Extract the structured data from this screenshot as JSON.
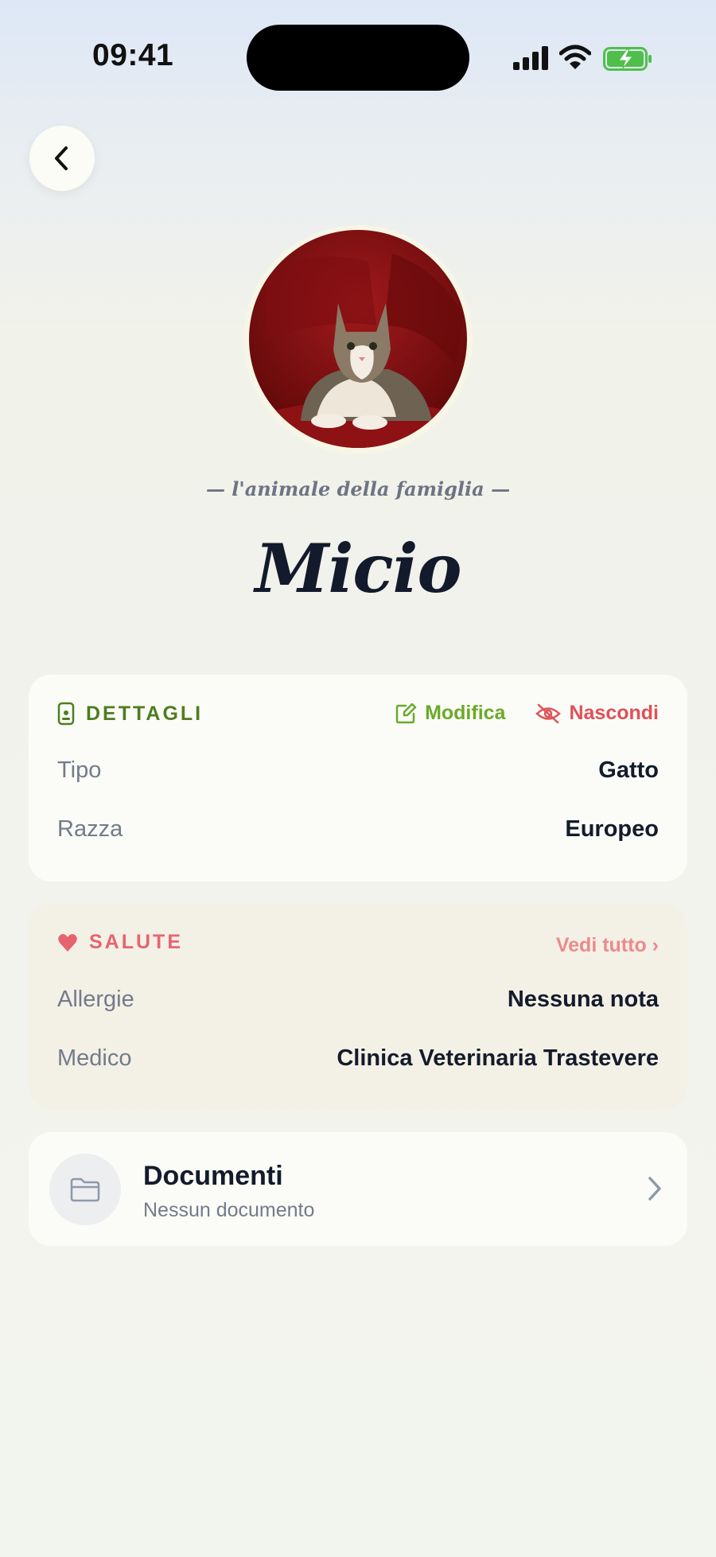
{
  "status": {
    "time": "09:41"
  },
  "profile": {
    "tagline": "— l'animale della famiglia —",
    "name": "Micio"
  },
  "details": {
    "title": "DETTAGLI",
    "edit_label": "Modifica",
    "hide_label": "Nascondi",
    "rows": [
      {
        "label": "Tipo",
        "value": "Gatto"
      },
      {
        "label": "Razza",
        "value": "Europeo"
      }
    ]
  },
  "health": {
    "title": "SALUTE",
    "see_all_label": "Vedi tutto ›",
    "rows": [
      {
        "label": "Allergie",
        "value": "Nessuna nota"
      },
      {
        "label": "Medico",
        "value": "Clinica Veterinaria Trastevere"
      }
    ]
  },
  "documents": {
    "title": "Documenti",
    "subtitle": "Nessun documento"
  },
  "colors": {
    "details_accent": "#4f7d1f",
    "edit_accent": "#6aaa2a",
    "hide_accent": "#e05058",
    "health_accent": "#e66470"
  },
  "icons": {
    "back": "chevron-left-icon",
    "details": "phone-tag-icon",
    "edit": "edit-icon",
    "hide": "eye-off-icon",
    "health": "heart-icon",
    "documents": "folder-icon",
    "documents_open": "chevron-right-icon"
  }
}
